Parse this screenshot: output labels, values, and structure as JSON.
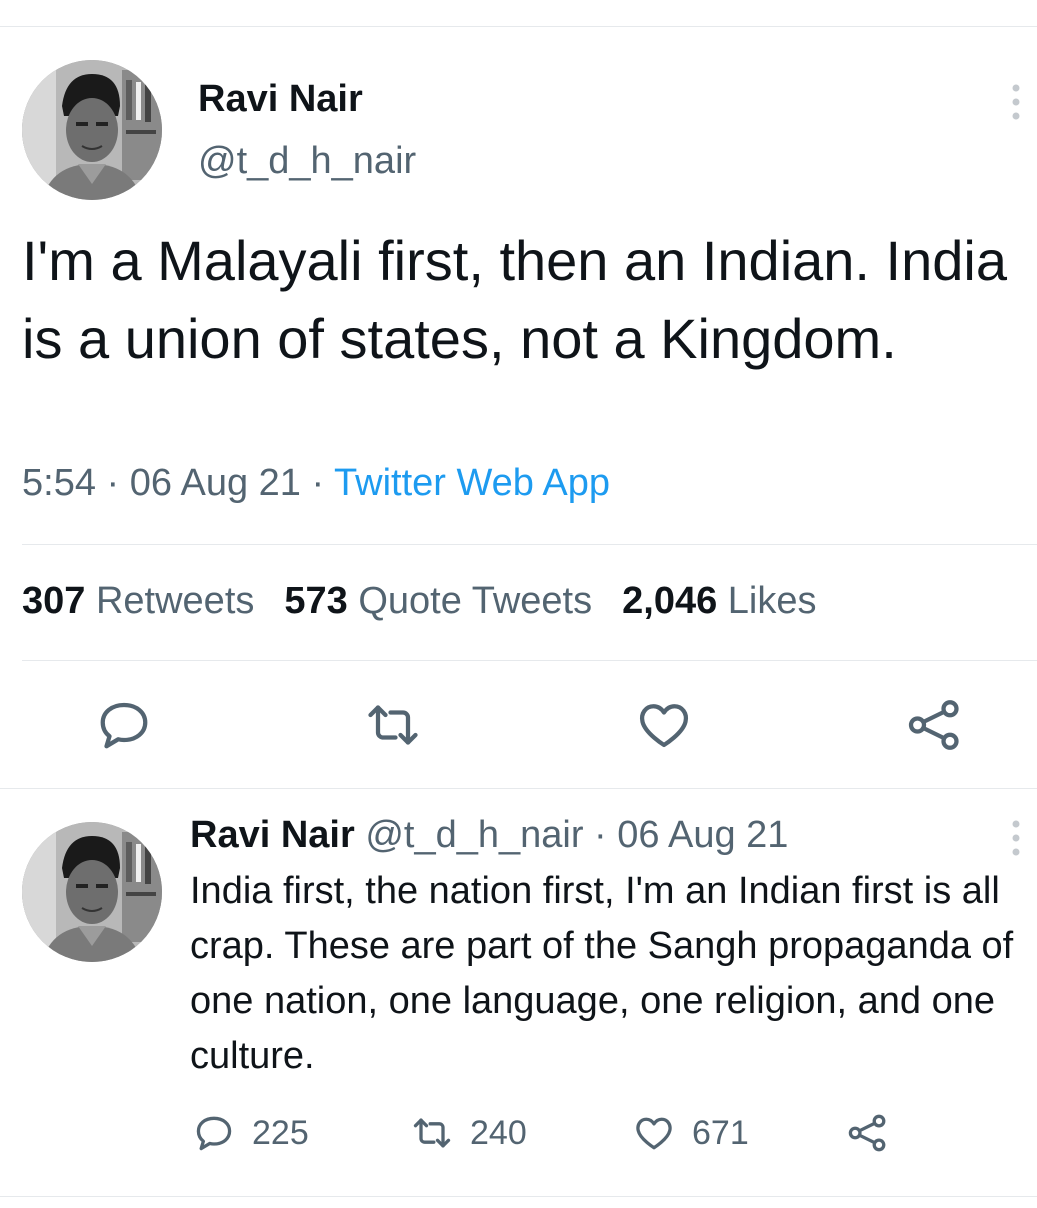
{
  "main_tweet": {
    "name": "Ravi Nair",
    "handle": "@t_d_h_nair",
    "text": "I'm a Malayali first, then an Indian. India is a union of states, not a Kingdom.",
    "time": "5:54",
    "date": "06 Aug 21",
    "app": "Twitter Web App",
    "stats": {
      "retweets_count": "307",
      "retweets_label": "Retweets",
      "quotes_count": "573",
      "quotes_label": "Quote Tweets",
      "likes_count": "2,046",
      "likes_label": "Likes"
    },
    "actions": [
      "reply-icon",
      "retweet-icon",
      "like-icon",
      "share-icon"
    ]
  },
  "reply_tweet": {
    "name": "Ravi Nair",
    "handle": "@t_d_h_nair",
    "separator": "·",
    "date": "06 Aug 21",
    "text": "India first, the nation first, I'm an Indian first is all crap. These are part of the Sangh propaganda of one nation, one language, one religion, and one culture.",
    "replies": "225",
    "retweets": "240",
    "likes": "671"
  },
  "colors": {
    "text": "#0f1419",
    "secondary": "#536471",
    "accent": "#1d9bf0",
    "divider": "#e6e9ec"
  }
}
